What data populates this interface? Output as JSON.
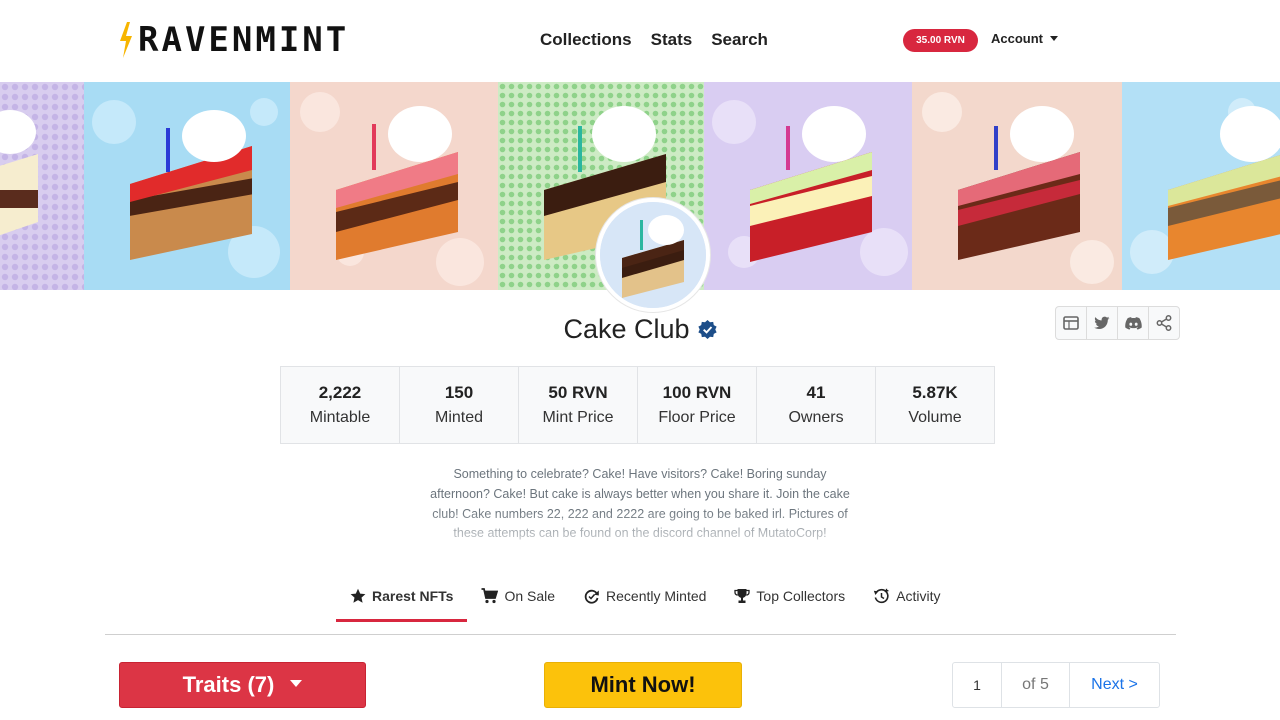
{
  "brand": {
    "name": "RAVENMINT",
    "bolt_color": "#f7b500"
  },
  "nav": {
    "links": [
      "Collections",
      "Stats",
      "Search"
    ]
  },
  "balance": "35.00 RVN",
  "account": {
    "label": "Account"
  },
  "collection": {
    "title": "Cake Club",
    "verified": true,
    "description": "Something to celebrate? Cake! Have visitors? Cake! Boring sunday afternoon? Cake! But cake is always better when you share it. Join the cake club! Cake numbers 22, 222 and 2222 are going to be baked irl. Pictures of these attempts can be found on the discord channel of MutatoCorp!"
  },
  "social_icons": [
    "website-icon",
    "twitter-icon",
    "discord-icon",
    "share-icon"
  ],
  "stats": [
    {
      "value": "2,222",
      "label": "Mintable"
    },
    {
      "value": "150",
      "label": "Minted"
    },
    {
      "value": "50 RVN",
      "label": "Mint Price"
    },
    {
      "value": "100 RVN",
      "label": "Floor Price"
    },
    {
      "value": "41",
      "label": "Owners"
    },
    {
      "value": "5.87K",
      "label": "Volume"
    }
  ],
  "tabs": [
    {
      "label": "Rarest NFTs",
      "icon": "star-icon",
      "active": true
    },
    {
      "label": "On Sale",
      "icon": "cart-icon",
      "active": false
    },
    {
      "label": "Recently Minted",
      "icon": "refresh-icon",
      "active": false
    },
    {
      "label": "Top Collectors",
      "icon": "trophy-icon",
      "active": false
    },
    {
      "label": "Activity",
      "icon": "history-icon",
      "active": false
    }
  ],
  "actions": {
    "traits_label": "Traits (7)",
    "mint_label": "Mint Now!"
  },
  "pagination": {
    "current": "1",
    "of_label": "of 5",
    "next_label": "Next >"
  },
  "colors": {
    "accent_red": "#dc3545",
    "mint_yellow": "#fcc20b",
    "link_blue": "#1a73e8"
  }
}
